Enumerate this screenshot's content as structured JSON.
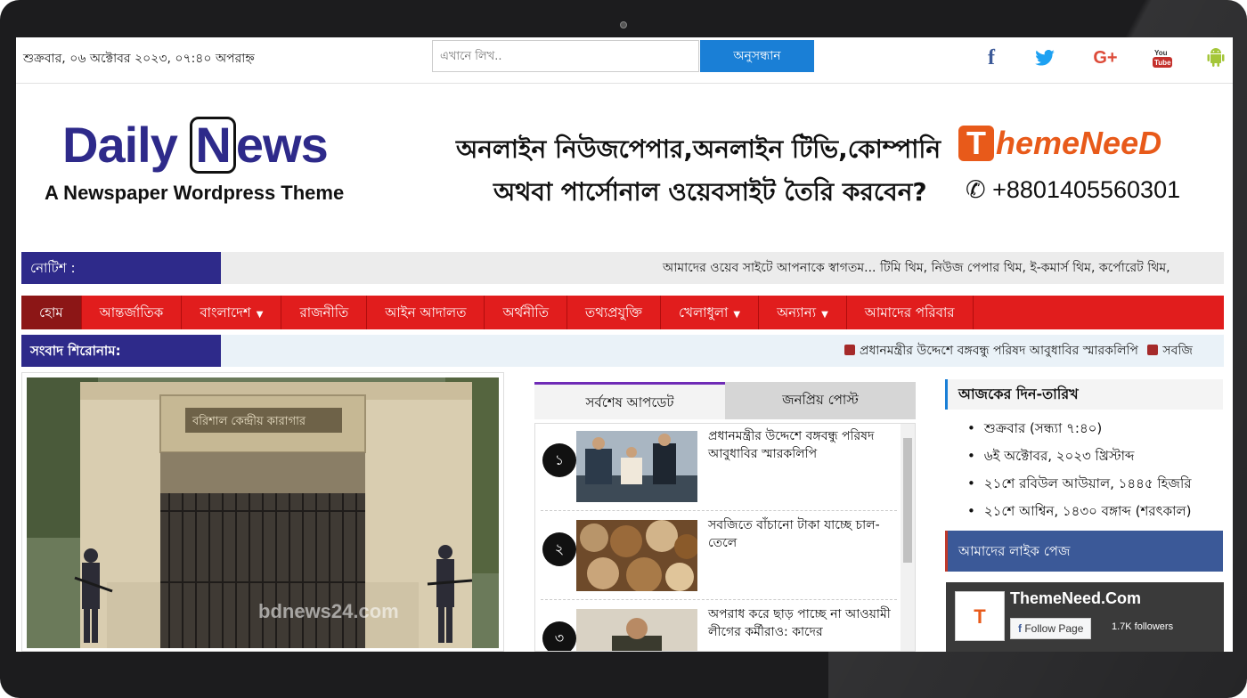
{
  "topbar": {
    "date": "শুক্রবার, ০৬ অক্টোবর ২০২৩, ০৭:৪০ অপরাহ্ন",
    "search_placeholder": "এখানে লিখ..",
    "search_button": "অনুসন্ধান",
    "social_icons": [
      "facebook-icon",
      "twitter-icon",
      "google-plus-icon",
      "youtube-icon",
      "android-icon"
    ],
    "social_colors": {
      "facebook": "#3b5998",
      "twitter": "#1da1f2",
      "google": "#dd4b39",
      "youtube": "#c4302b",
      "android": "#a4c639"
    }
  },
  "header": {
    "logo_text_start": "Daily ",
    "logo_text_boxed": "N",
    "logo_text_end": "ews",
    "logo_tagline": "A Newspaper Wordpress Theme",
    "ad_line1": "অনলাইন নিউজপেপার,অনলাইন টিভি,কোম্পানি",
    "ad_line2": "অথবা পার্সোনাল ওয়েবসাইট তৈরি করবেন?",
    "ad_brand_icon": "T",
    "ad_brand": "hemeNeeD",
    "ad_phone_icon": "phone-icon",
    "ad_phone": "+8801405560301"
  },
  "notice": {
    "label": "নোটিশ :",
    "text": "আমাদের ওয়েব সাইটে আপনাকে স্বাগতম... টিমি থিম, নিউজ পেপার থিম, ই-কমার্স থিম, কর্পোরেট থিম,"
  },
  "nav": [
    {
      "label": "হোম",
      "dropdown": false,
      "active": true
    },
    {
      "label": "আন্তর্জাতিক",
      "dropdown": false,
      "active": false
    },
    {
      "label": "বাংলাদেশ",
      "dropdown": true,
      "active": false
    },
    {
      "label": "রাজনীতি",
      "dropdown": false,
      "active": false
    },
    {
      "label": "আইন আদালত",
      "dropdown": false,
      "active": false
    },
    {
      "label": "অর্থনীতি",
      "dropdown": false,
      "active": false
    },
    {
      "label": "তথ্যপ্রযুক্তি",
      "dropdown": false,
      "active": false
    },
    {
      "label": "খেলাধুলা",
      "dropdown": true,
      "active": false
    },
    {
      "label": "অন্যান্য",
      "dropdown": true,
      "active": false
    },
    {
      "label": "আমাদের পরিবার",
      "dropdown": false,
      "active": false
    }
  ],
  "headlines": {
    "label": "সংবাদ শিরোনাম:",
    "ticker1": "প্রধানমন্ত্রীর উদ্দেশে বঙ্গবন্ধু পরিষদ আবুধাবির স্মারকলিপি",
    "ticker2": "সবজি"
  },
  "feature": {
    "watermark": "bdnews24.com"
  },
  "tabs": {
    "latest": "সর্বশেষ আপডেট",
    "popular": "জনপ্রিয় পোস্ট"
  },
  "posts": [
    {
      "num": "১",
      "title": "প্রধানমন্ত্রীর উদ্দেশে বঙ্গবন্ধু পরিষদ আবুধাবির স্মারকলিপি"
    },
    {
      "num": "২",
      "title": "সবজিতে বাঁচানো টাকা যাচ্ছে চাল-তেলে"
    },
    {
      "num": "৩",
      "title": "অপরাধ করে ছাড় পাচ্ছে না আওয়ামী লীগের কর্মীরাও: কাদের"
    }
  ],
  "sidebar": {
    "date_title": "আজকের দিন-তারিখ",
    "date_items": [
      "শুক্রবার (সন্ধ্যা ৭:৪০)",
      "৬ই অক্টোবর, ২০২৩ খ্রিস্টাব্দ",
      "২১শে রবিউল আউয়াল, ১৪৪৫ হিজরি",
      "২১শে আশ্বিন, ১৪৩০ বঙ্গাব্দ (শরৎকাল)"
    ],
    "like_title": "আমাদের লাইক পেজ",
    "fb_name": "ThemeNeed.Com",
    "fb_button": "Follow Page",
    "fb_followers": "1.7K followers"
  }
}
